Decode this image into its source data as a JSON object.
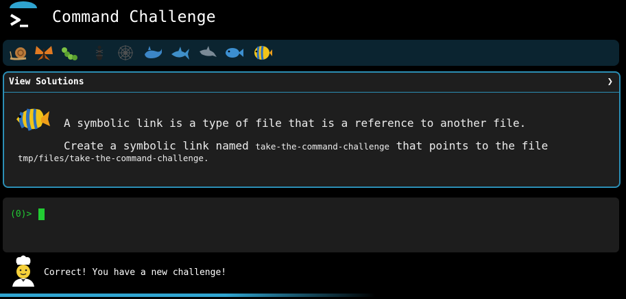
{
  "app": {
    "title": "Command Challenge",
    "logo_icon": "terminal-prompt-icon"
  },
  "levels": [
    {
      "name": "snail",
      "icon": "snail-icon"
    },
    {
      "name": "butterfly",
      "icon": "butterfly-icon"
    },
    {
      "name": "caterpillar",
      "icon": "caterpillar-icon"
    },
    {
      "name": "ant",
      "icon": "ant-icon"
    },
    {
      "name": "spider-web",
      "icon": "spider-web-icon"
    },
    {
      "name": "whale",
      "icon": "whale-icon"
    },
    {
      "name": "shark",
      "icon": "shark-icon"
    },
    {
      "name": "dolphin",
      "icon": "dolphin-icon"
    },
    {
      "name": "fish",
      "icon": "fish-icon"
    },
    {
      "name": "tropical-fish",
      "icon": "tropical-fish-icon",
      "current": true
    }
  ],
  "challenge": {
    "header_label": "View Solutions",
    "text_1": "A symbolic link is a type of file that is a reference to another file.",
    "text_2_prefix": "Create a symbolic link named ",
    "text_2_code": "take-the-command-challenge",
    "text_2_suffix": " that points to the file",
    "text_3_code": "tmp/files/take-the-command-challenge",
    "text_3_suffix": "."
  },
  "terminal": {
    "prompt": "(0)>"
  },
  "feedback": {
    "message": "Correct! You have a new challenge!",
    "avatar_icon": "chef-icon"
  },
  "progress": {
    "fraction": 0.6
  },
  "colors": {
    "accent": "#2b8fb6",
    "prompt_green": "#22cc33",
    "panel_bg": "#1e1e1e",
    "level_bar_bg": "#0b2430"
  }
}
